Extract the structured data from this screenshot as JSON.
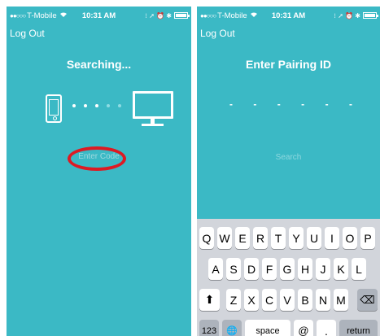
{
  "status_bar": {
    "signal": "●●○○○",
    "carrier": "T-Mobile",
    "wifi_icon": "wifi-icon",
    "time": "10:31 AM",
    "right_icons": "⁝ ➚ ⏰ ✱"
  },
  "left_screen": {
    "log_out": "Log Out",
    "title": "Searching...",
    "enter_code": "Enter Code",
    "annotation_color": "#dd1a23"
  },
  "right_screen": {
    "log_out": "Log Out",
    "title": "Enter Pairing ID",
    "pin_dashes": [
      "-",
      "-",
      "-",
      "-",
      "-",
      "-"
    ],
    "search": "Search"
  },
  "keyboard": {
    "row1": [
      "Q",
      "W",
      "E",
      "R",
      "T",
      "Y",
      "U",
      "I",
      "O",
      "P"
    ],
    "row2": [
      "A",
      "S",
      "D",
      "F",
      "G",
      "H",
      "J",
      "K",
      "L"
    ],
    "row3": [
      "Z",
      "X",
      "C",
      "V",
      "B",
      "N",
      "M"
    ],
    "shift": "⬆",
    "delete": "⌫",
    "num": "123",
    "globe": "🌐",
    "space": "space",
    "at": "@",
    "dot": ".",
    "return": "return"
  },
  "colors": {
    "background": "#3bb9c5",
    "keyboard": "#d2d5db",
    "annotation": "#dd1a23"
  }
}
